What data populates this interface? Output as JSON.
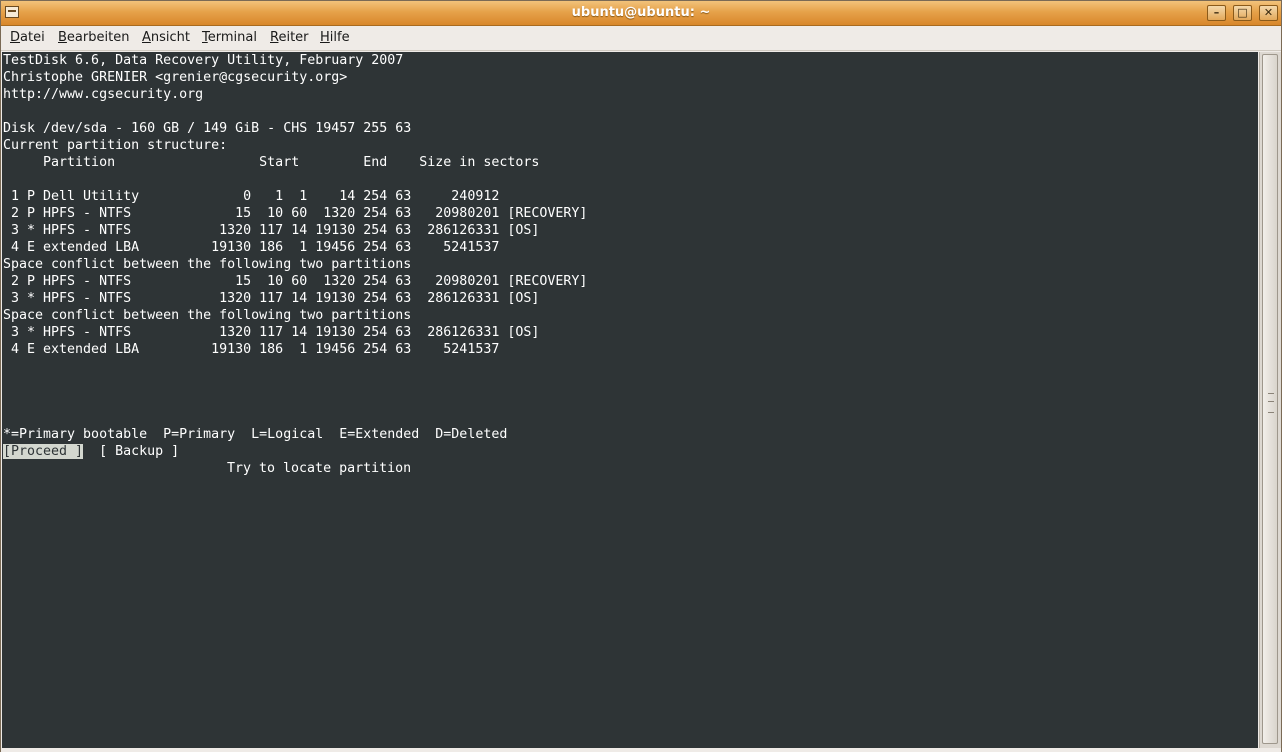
{
  "window": {
    "title": "ubuntu@ubuntu: ~",
    "buttons": {
      "minimize": "–",
      "maximize": "□",
      "close": "✕"
    }
  },
  "menubar": {
    "items": [
      {
        "key": "D",
        "rest": "atei"
      },
      {
        "key": "B",
        "rest": "earbeiten"
      },
      {
        "key": "A",
        "rest": "nsicht"
      },
      {
        "key": "T",
        "rest": "erminal"
      },
      {
        "key": "R",
        "rest": "eiter"
      },
      {
        "key": "H",
        "rest": "ilfe"
      }
    ]
  },
  "terminal": {
    "header": [
      "TestDisk 6.6, Data Recovery Utility, February 2007",
      "Christophe GRENIER <grenier@cgsecurity.org>",
      "http://www.cgsecurity.org"
    ],
    "disk_line": "Disk /dev/sda - 160 GB / 149 GiB - CHS 19457 255 63",
    "structure_label": "Current partition structure:",
    "columns_line": "     Partition                  Start        End    Size in sectors",
    "partitions": [
      " 1 P Dell Utility             0   1  1    14 254 63     240912",
      " 2 P HPFS - NTFS             15  10 60  1320 254 63   20980201 [RECOVERY]",
      " 3 * HPFS - NTFS           1320 117 14 19130 254 63  286126331 [OS]",
      " 4 E extended LBA         19130 186  1 19456 254 63    5241537"
    ],
    "conflicts": [
      {
        "message": "Space conflict between the following two partitions",
        "rows": [
          " 2 P HPFS - NTFS             15  10 60  1320 254 63   20980201 [RECOVERY]",
          " 3 * HPFS - NTFS           1320 117 14 19130 254 63  286126331 [OS]"
        ]
      },
      {
        "message": "Space conflict between the following two partitions",
        "rows": [
          " 3 * HPFS - NTFS           1320 117 14 19130 254 63  286126331 [OS]",
          " 4 E extended LBA         19130 186  1 19456 254 63    5241537"
        ]
      }
    ],
    "legend": "*=Primary bootable  P=Primary  L=Logical  E=Extended  D=Deleted",
    "actions": {
      "proceed": "[Proceed ]",
      "backup": "[ Backup ]"
    },
    "hint": "Try to locate partition"
  }
}
